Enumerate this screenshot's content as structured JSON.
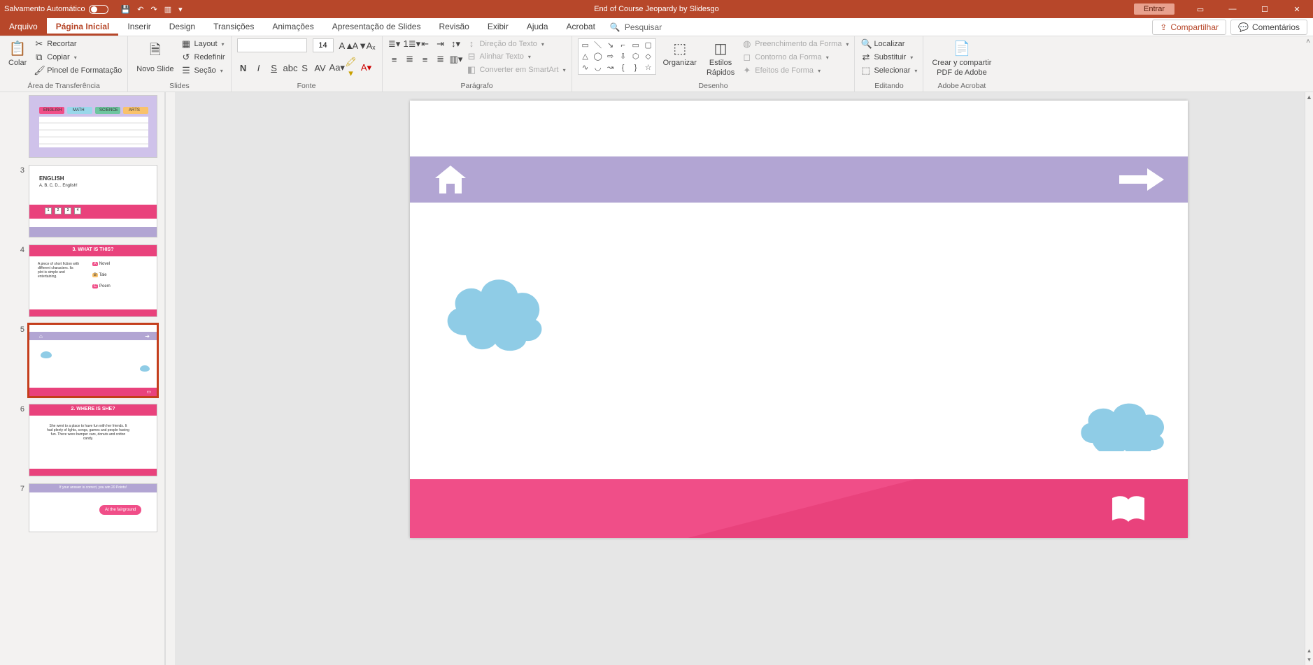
{
  "titlebar": {
    "autosave_label": "Salvamento Automático",
    "doc_title": "End of Course Jeopardy by Slidesgo",
    "signin": "Entrar"
  },
  "tabs": {
    "file": "Arquivo",
    "home": "Página Inicial",
    "insert": "Inserir",
    "design": "Design",
    "transitions": "Transições",
    "animations": "Animações",
    "slideshow": "Apresentação de Slides",
    "review": "Revisão",
    "view": "Exibir",
    "help": "Ajuda",
    "acrobat": "Acrobat",
    "search": "Pesquisar",
    "share": "Compartilhar",
    "comments": "Comentários"
  },
  "ribbon": {
    "clipboard": {
      "paste": "Colar",
      "cut": "Recortar",
      "copy": "Copiar",
      "painter": "Pincel de Formatação",
      "title": "Área de Transferência"
    },
    "slides": {
      "new": "Novo Slide",
      "layout": "Layout",
      "reset": "Redefinir",
      "section": "Seção",
      "title": "Slides"
    },
    "font": {
      "size": "14",
      "title": "Fonte"
    },
    "paragraph": {
      "textdir": "Direção do Texto",
      "align": "Alinhar Texto",
      "smartart": "Converter em SmartArt",
      "title": "Parágrafo"
    },
    "drawing": {
      "arrange": "Organizar",
      "qstyles1": "Estilos",
      "qstyles2": "Rápidos",
      "fill": "Preenchimento da Forma",
      "outline": "Contorno da Forma",
      "effects": "Efeitos de Forma",
      "title": "Desenho"
    },
    "editing": {
      "find": "Localizar",
      "replace": "Substituir",
      "select": "Selecionar",
      "title": "Editando"
    },
    "adobe": {
      "line1": "Crear y compartir",
      "line2": "PDF de Adobe",
      "title": "Adobe Acrobat"
    }
  },
  "thumbs": {
    "n2": "",
    "n3": "3",
    "n4": "4",
    "n5": "5",
    "n6": "6",
    "n7": "7",
    "s3_title": "ENGLISH",
    "s3_sub": "A, B, C, D... English!",
    "s4_title": "3. WHAT IS THIS?",
    "s4_a": "Novel",
    "s4_b": "Tale",
    "s4_c": "Poem",
    "s4_body": "A piece of short fiction with different characters. Its plot is simple and entertaining.",
    "s6_title": "2. WHERE IS SHE?",
    "s6_body": "She went to a place to have fun with her friends. It had plenty of lights, songs, games and people having fun. There were bumper cars, donuts and cotton candy.",
    "s7_top": "If your answer is correct, you win 20 Points!",
    "s7_bubble": "At the fairground",
    "s2_colA": "ENGLISH",
    "s2_colB": "MATH",
    "s2_colC": "SCIENCE",
    "s2_colD": "ARTS"
  }
}
